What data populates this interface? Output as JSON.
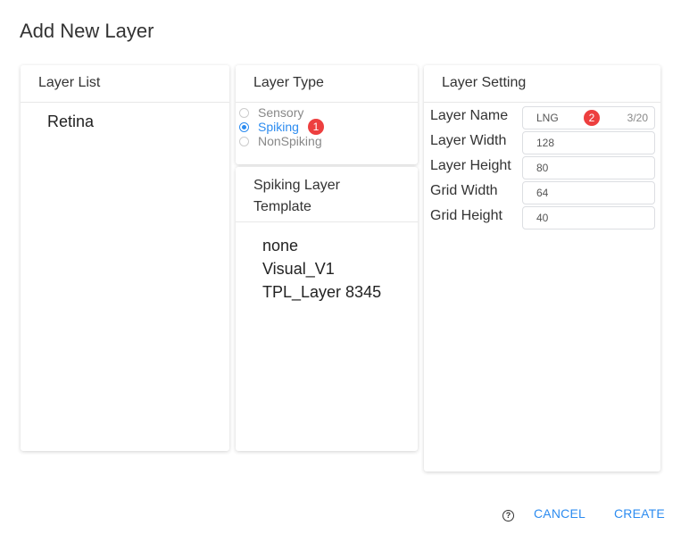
{
  "dialog": {
    "title": "Add New Layer"
  },
  "layer_list": {
    "header": "Layer List",
    "items": [
      "Retina"
    ]
  },
  "layer_type": {
    "header": "Layer Type",
    "options": [
      {
        "label": "Sensory",
        "checked": false
      },
      {
        "label": "Spiking",
        "checked": true,
        "badge": "1"
      },
      {
        "label": "NonSpiking",
        "checked": false
      }
    ]
  },
  "template": {
    "header_line1": "Spiking Layer",
    "header_line2": "Template",
    "items": [
      "none",
      "Visual_V1",
      "TPL_Layer 8345"
    ]
  },
  "setting": {
    "header": "Layer Setting",
    "fields": [
      {
        "label": "Layer Name",
        "value": "LNG",
        "count": "3/20",
        "badge": "2"
      },
      {
        "label": "Layer Width",
        "value": "128"
      },
      {
        "label": "Layer Height",
        "value": "80"
      },
      {
        "label": "Grid Width",
        "value": "64"
      },
      {
        "label": "Grid Height",
        "value": "40"
      }
    ]
  },
  "footer": {
    "help_icon": "question-circle-icon",
    "cancel_label": "CANCEL",
    "create_label": "CREATE"
  },
  "colors": {
    "accent": "#2d8cf0",
    "badge": "#ed3f3f"
  }
}
